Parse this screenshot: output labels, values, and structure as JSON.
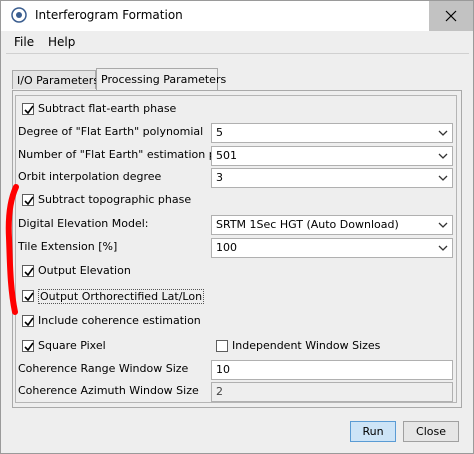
{
  "window": {
    "title": "Interferogram Formation"
  },
  "menu": {
    "file": "File",
    "help": "Help"
  },
  "tabs": [
    {
      "label": "I/O Parameters",
      "active": false
    },
    {
      "label": "Processing Parameters",
      "active": true
    }
  ],
  "form": {
    "subtract_flat_earth": {
      "label": "Subtract flat-earth phase",
      "checked": true
    },
    "degree_flat_earth": {
      "label": "Degree of \"Flat Earth\" polynomial",
      "value": "5"
    },
    "num_flat_earth_points": {
      "label": "Number of \"Flat Earth\" estimation points",
      "value": "501"
    },
    "orbit_interp_degree": {
      "label": "Orbit interpolation degree",
      "value": "3"
    },
    "subtract_topo": {
      "label": "Subtract topographic phase",
      "checked": true
    },
    "dem": {
      "label": "Digital Elevation Model:",
      "value": "SRTM 1Sec HGT (Auto Download)"
    },
    "tile_extension": {
      "label": "Tile Extension [%]",
      "value": "100"
    },
    "output_elevation": {
      "label": "Output Elevation",
      "checked": true
    },
    "output_ortho_latlon": {
      "label": "Output Orthorectified Lat/Lon",
      "checked": true
    },
    "include_coherence": {
      "label": "Include coherence estimation",
      "checked": true
    },
    "square_pixel": {
      "label": "Square Pixel",
      "checked": true
    },
    "independent_window": {
      "label": "Independent Window Sizes",
      "checked": false
    },
    "coh_range_window": {
      "label": "Coherence Range Window Size",
      "value": "10"
    },
    "coh_azimuth_window": {
      "label": "Coherence Azimuth Window Size",
      "value": "2"
    }
  },
  "buttons": {
    "run": "Run",
    "close": "Close"
  },
  "colors": {
    "annotation_mark": "#ff0000",
    "primary_button": "#cde4f7"
  }
}
